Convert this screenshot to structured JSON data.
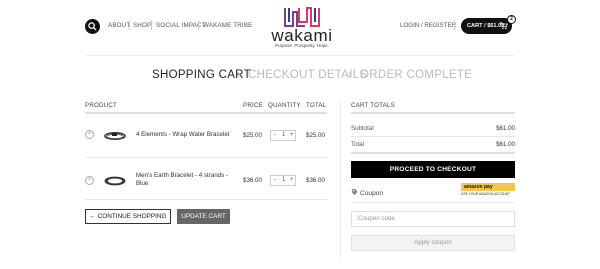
{
  "header": {
    "nav": [
      "ABOUT",
      "SHOP",
      "SOCIAL IMPACT",
      "WAKAME TRIBE"
    ],
    "brand": "wakami",
    "tagline": "Purpose. Prosperity. Hope.",
    "login": "LOGIN / REGISTER",
    "cart_label": "CART / $61.00",
    "cart_count": "2"
  },
  "steps": [
    "SHOPPING CART",
    "CHECKOUT DETAILS",
    "ORDER COMPLETE"
  ],
  "step_separator": "›",
  "cart": {
    "columns": [
      "PRODUCT",
      "PRICE",
      "QUANTITY",
      "TOTAL"
    ],
    "items": [
      {
        "name": "4 Elements - Wrap Water Bracelet",
        "price": "$25.00",
        "qty": "1",
        "total": "$25.00"
      },
      {
        "name_line1": "Men's Earth Bracelet - 4 strands -",
        "name_line2": "Blue",
        "price": "$36.00",
        "qty": "1",
        "total": "$36.00"
      }
    ],
    "continue_label": "← CONTINUE SHOPPING",
    "update_label": "UPDATE CART",
    "remove_symbol": "×",
    "minus": "-",
    "plus": "+"
  },
  "totals": {
    "title": "CART TOTALS",
    "subtotal_label": "Subtotal",
    "subtotal_value": "$61.00",
    "total_label": "Total",
    "total_value": "$61.00",
    "checkout_label": "PROCEED TO CHECKOUT",
    "coupon_label": "Coupon",
    "coupon_placeholder": "Coupon code",
    "apply_label": "Apply coupon",
    "amazon_brand": "amazon pay",
    "amazon_sub": "USE YOUR AMAZON ACCOUNT"
  },
  "colors": {
    "accent_black": "#000000",
    "logo_purple": "#7b3f8e",
    "logo_pink": "#d23c6e",
    "amazon_yellow": "#f5c54a"
  }
}
